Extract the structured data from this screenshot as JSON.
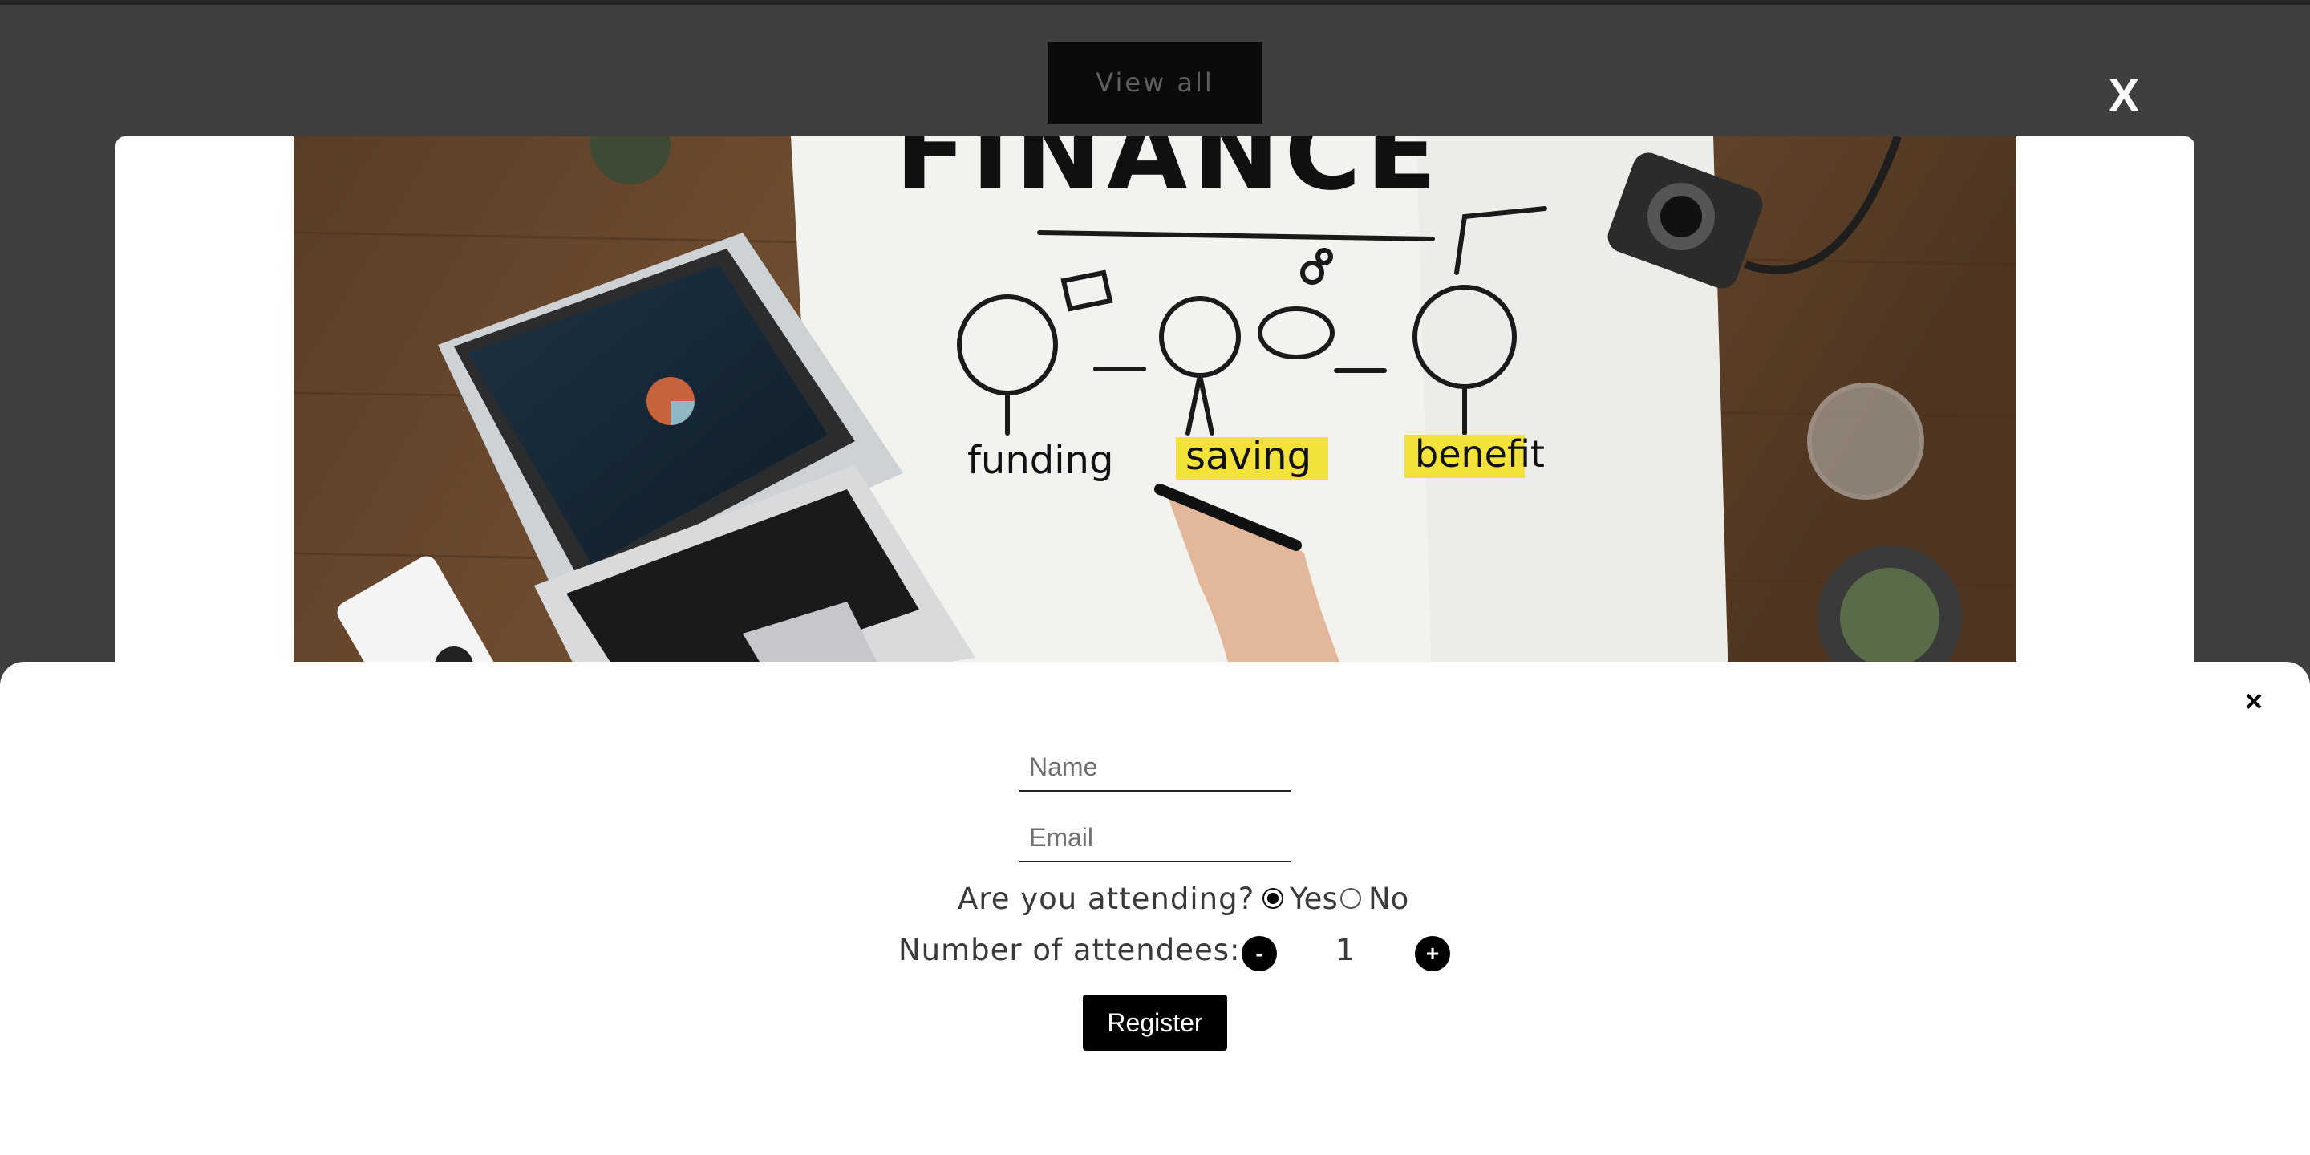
{
  "header": {
    "view_all_label": "View all",
    "close_label": "X"
  },
  "hero": {
    "headline": "FINANCE",
    "labels": [
      "funding",
      "saving",
      "benefit"
    ]
  },
  "form": {
    "close_label": "×",
    "name_placeholder": "Name",
    "email_placeholder": "Email",
    "attending_label": "Are you attending?",
    "attending_options": [
      "Yes",
      "No"
    ],
    "attending_selected": "Yes",
    "attendees_label": "Number of attendees:",
    "minus_label": "-",
    "plus_label": "+",
    "attendees_count": "1",
    "register_label": "Register"
  },
  "colors": {
    "overlay": "#3f3f3f",
    "button_dark": "#0b0b0b",
    "primary": "#000000",
    "highlight": "#f2e23a"
  },
  "icons": {
    "overlay_close": "close-icon",
    "sheet_close": "close-icon"
  }
}
